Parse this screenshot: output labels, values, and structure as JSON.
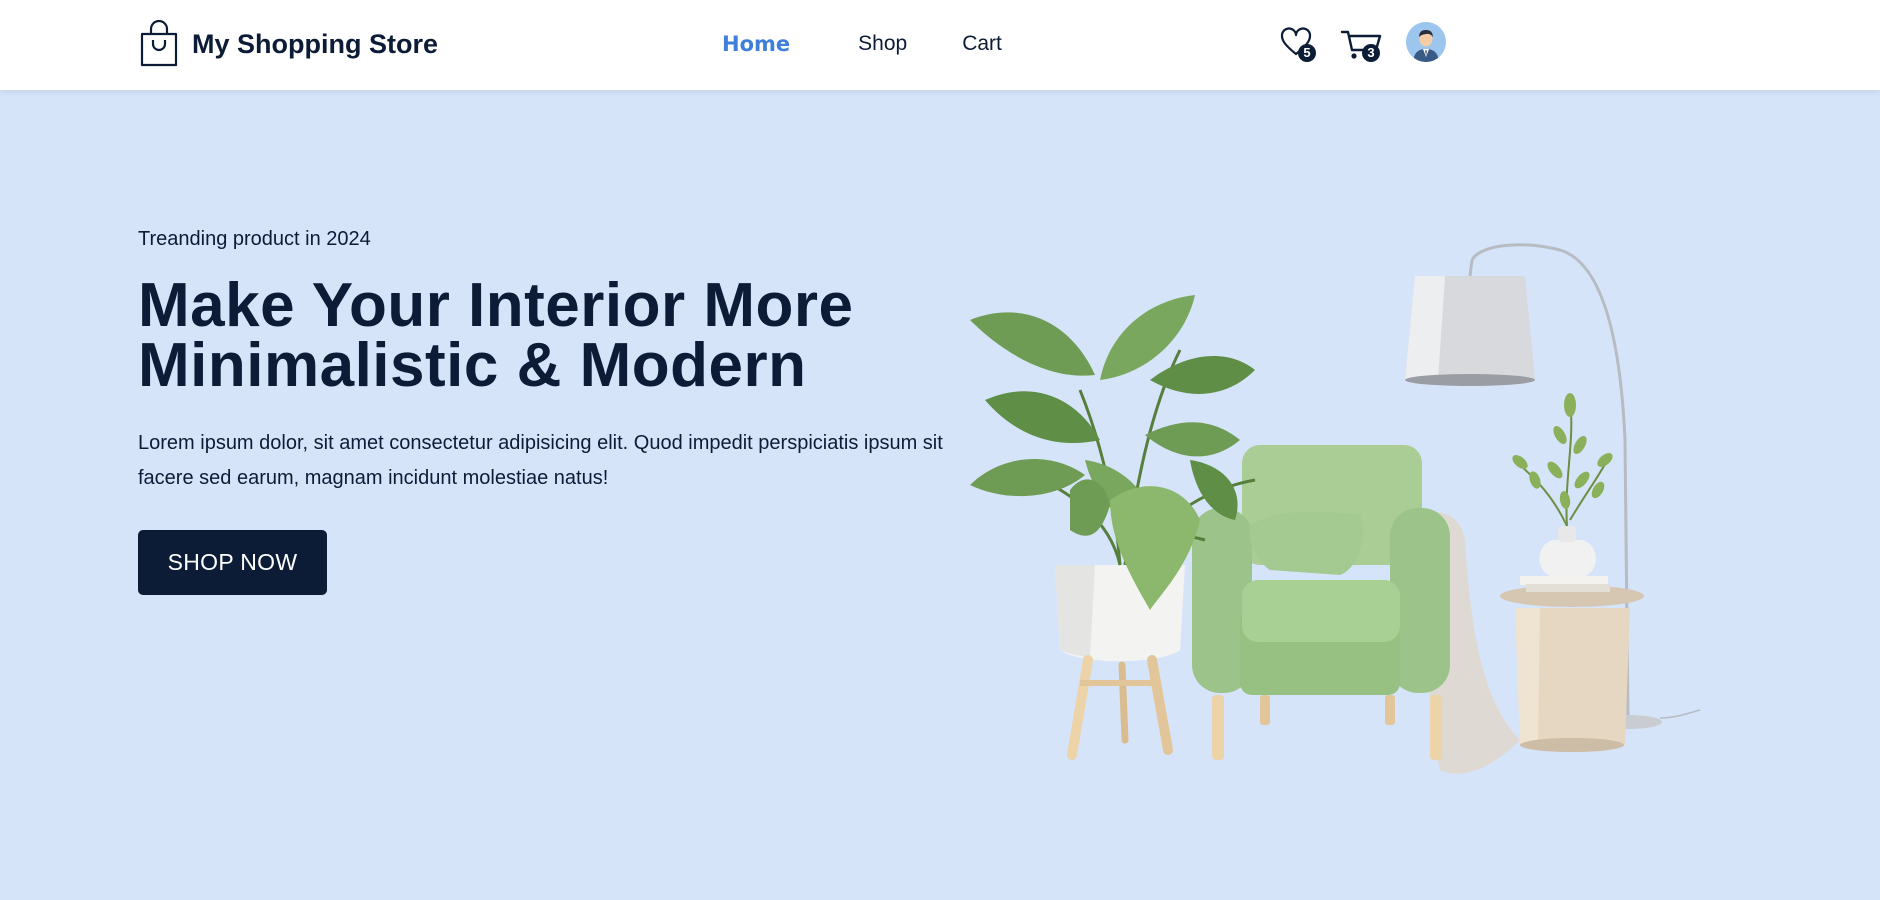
{
  "header": {
    "brand_name": "My Shopping Store",
    "brand_icon": "shopping-bag-icon",
    "nav": [
      {
        "label": "Home",
        "active": true
      },
      {
        "label": "Shop",
        "active": false
      },
      {
        "label": "Cart",
        "active": false
      }
    ],
    "wishlist": {
      "icon": "heart-icon",
      "count": "5"
    },
    "cart": {
      "icon": "cart-icon",
      "count": "3"
    },
    "user": {
      "icon": "user-avatar-icon"
    }
  },
  "hero": {
    "tagline": "Treanding product in 2024",
    "headline": "Make Your Interior More Minimalistic & Modern",
    "description": "Lorem ipsum dolor, sit amet consectetur adipisicing elit. Quod impedit perspiciatis ipsum sit facere sed earum, magnam incidunt molestiae natus!",
    "cta_label": "SHOP NOW",
    "image_subject": "green armchair with potted plant, floor lamp and side table"
  },
  "colors": {
    "background": "#d6e4fa",
    "navbar": "#ffffff",
    "text_dark": "#0c1c36",
    "accent": "#3e7fd9",
    "button": "#0c1c36",
    "chair_green": "#9cc48a"
  }
}
